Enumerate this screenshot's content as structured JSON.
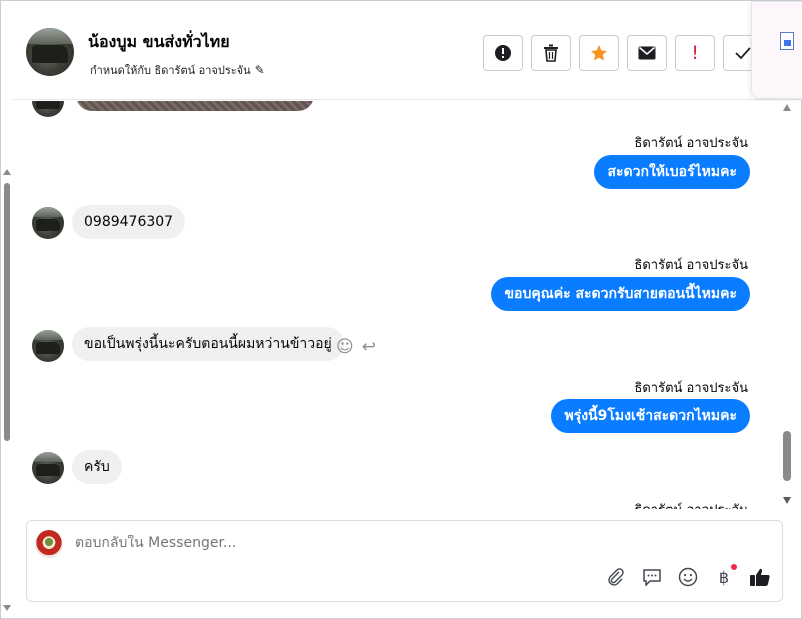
{
  "header": {
    "contact_name": "น้องบูม ขนส่งทั่วไทย",
    "assign_text": "กำหนดให้กับ ธิดารัตน์ อาจประจัน",
    "actions": [
      {
        "name": "report-button",
        "icon": "alert-circle-icon"
      },
      {
        "name": "delete-button",
        "icon": "trash-icon"
      },
      {
        "name": "star-button",
        "icon": "star-icon",
        "color": "#f7931e"
      },
      {
        "name": "mark-unread-button",
        "icon": "envelope-icon"
      },
      {
        "name": "follow-up-button",
        "icon": "exclamation-icon",
        "color": "#e41e3f"
      },
      {
        "name": "mark-done-button",
        "icon": "check-icon"
      }
    ]
  },
  "messages": [
    {
      "type": "photo",
      "from": "contact"
    },
    {
      "type": "outgoing",
      "sender": "ธิดารัตน์ อาจประจัน",
      "text": "สะดวกให้เบอร์ไหมคะ"
    },
    {
      "type": "incoming",
      "text": "0989476307"
    },
    {
      "type": "outgoing",
      "sender": "ธิดารัตน์ อาจประจัน",
      "text": "ขอบคุณค่ะ สะดวกรับสายตอนนี้ไหมคะ"
    },
    {
      "type": "incoming",
      "text": "ขอเป็นพรุ่งนี้นะครับตอนนี้ผมหว่านข้าวอยู่"
    },
    {
      "type": "outgoing",
      "sender": "ธิดารัตน์ อาจประจัน",
      "text": "พรุ่งนี้9โมงเช้าสะดวกไหมคะ"
    },
    {
      "type": "incoming",
      "text": "ครับ"
    },
    {
      "type": "outgoing-partial",
      "sender": "ธิดารัตน์ อาจประจัน"
    }
  ],
  "composer": {
    "placeholder": "ตอบกลับใน Messenger...",
    "tools": [
      "paperclip-icon",
      "saved-reply-icon",
      "emoji-icon",
      "baht-payment-icon",
      "thumbs-up-icon"
    ]
  },
  "colors": {
    "outgoing_bubble": "#0a7cff",
    "incoming_bubble": "#f0f0f0",
    "star": "#f7931e",
    "alert": "#e41e3f",
    "notification_dot": "#f02849"
  }
}
